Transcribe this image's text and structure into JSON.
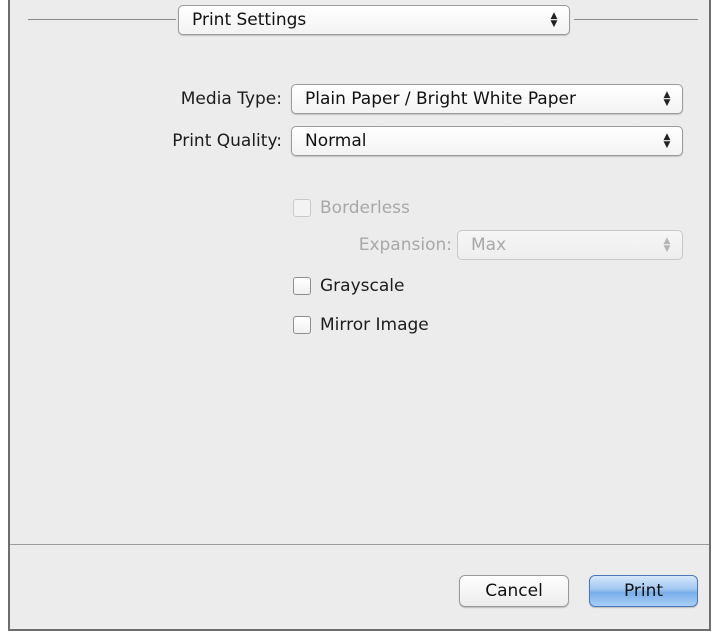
{
  "panel_selector": {
    "value": "Print Settings"
  },
  "media_type": {
    "label": "Media Type:",
    "value": "Plain Paper / Bright White Paper"
  },
  "print_quality": {
    "label": "Print Quality:",
    "value": "Normal"
  },
  "borderless": {
    "label": "Borderless",
    "checked": false,
    "enabled": false
  },
  "expansion": {
    "label": "Expansion:",
    "value": "Max",
    "enabled": false
  },
  "grayscale": {
    "label": "Grayscale",
    "checked": false
  },
  "mirror_image": {
    "label": "Mirror Image",
    "checked": false
  },
  "buttons": {
    "cancel": "Cancel",
    "print": "Print"
  },
  "icons": {
    "popup_arrows": "up-down-arrows-icon"
  },
  "colors": {
    "dialog_bg": "#ececec",
    "default_button": "#79adea"
  }
}
